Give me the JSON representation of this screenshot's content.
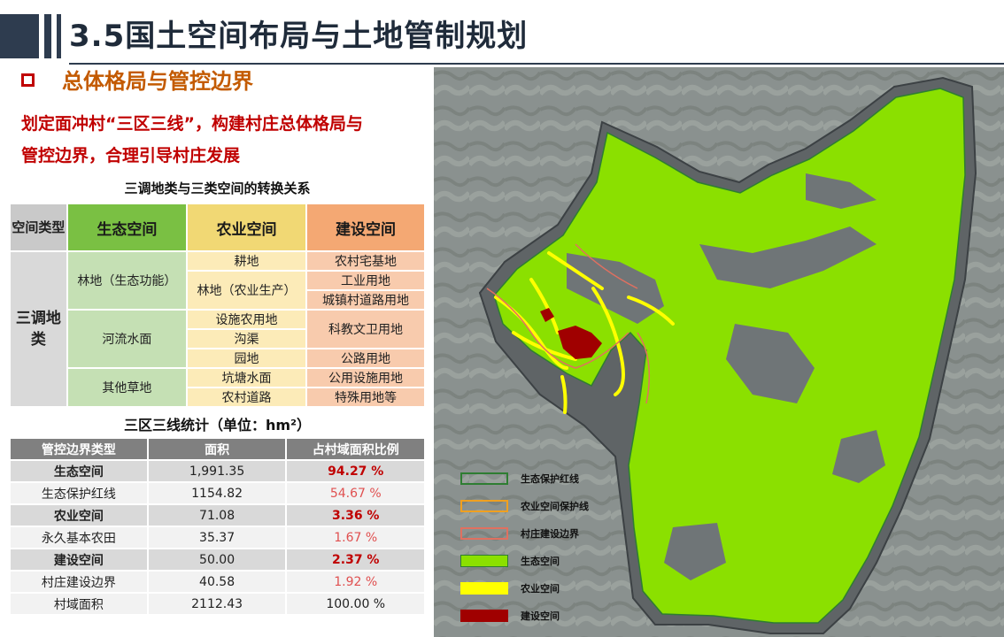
{
  "header": {
    "title": "3.5国土空间布局与土地管制规划"
  },
  "section": {
    "title": "总体格局与管控边界"
  },
  "intro": {
    "line1": "划定面冲村“三区三线”，构建村庄总体格局与",
    "line2": "管控边界，合理引导村庄发展"
  },
  "conversion_table": {
    "caption": "三调地类与三类空间的转换关系",
    "header": {
      "kind": "空间类型",
      "eco": "生态空间",
      "agr": "农业空间",
      "bld": "建设空间"
    },
    "row_label": "三调地类",
    "eco": [
      "林地（生态功能）",
      "河流水面",
      "其他草地"
    ],
    "agr": [
      "耕地",
      "林地（农业生产）",
      "设施农用地",
      "沟渠",
      "园地",
      "坑塘水面",
      "农村道路"
    ],
    "bld": [
      "农村宅基地",
      "工业用地",
      "城镇村道路用地",
      "科教文卫用地",
      "公路用地",
      "公用设施用地",
      "特殊用地等"
    ]
  },
  "stats_table": {
    "caption": "三区三线统计（单位：hm²）",
    "columns": [
      "管控边界类型",
      "面积",
      "占村域面积比例"
    ],
    "rows": [
      {
        "type": "生态空间",
        "area": "1,991.35",
        "ratio": "94.27 %"
      },
      {
        "type": "生态保护红线",
        "area": "1154.82",
        "ratio": "54.67 %"
      },
      {
        "type": "农业空间",
        "area": "71.08",
        "ratio": "3.36 %"
      },
      {
        "type": "永久基本农田",
        "area": "35.37",
        "ratio": "1.67 %"
      },
      {
        "type": "建设空间",
        "area": "50.00",
        "ratio": "2.37 %"
      },
      {
        "type": "村庄建设边界",
        "area": "40.58",
        "ratio": "1.92 %"
      },
      {
        "type": "村域面积",
        "area": "2112.43",
        "ratio": "100.00 %"
      }
    ]
  },
  "legend": {
    "items": [
      {
        "label": "生态保护红线",
        "kind": "outline",
        "color": "#2e7d32"
      },
      {
        "label": "农业空间保护线",
        "kind": "outline",
        "color": "#f0a020"
      },
      {
        "label": "村庄建设边界",
        "kind": "outline",
        "color": "#e07060"
      },
      {
        "label": "生态空间",
        "kind": "fill",
        "color": "#8be000"
      },
      {
        "label": "农业空间",
        "kind": "fill",
        "color": "#ffff00"
      },
      {
        "label": "建设空间",
        "kind": "fill",
        "color": "#a00000"
      }
    ]
  },
  "colors": {
    "brand_dark": "#2e3c4f",
    "accent_red": "#c00000",
    "accent_orange": "#c35a00",
    "eco_green": "#8be000",
    "agr_yellow": "#ffff00",
    "bld_red": "#a00000"
  }
}
